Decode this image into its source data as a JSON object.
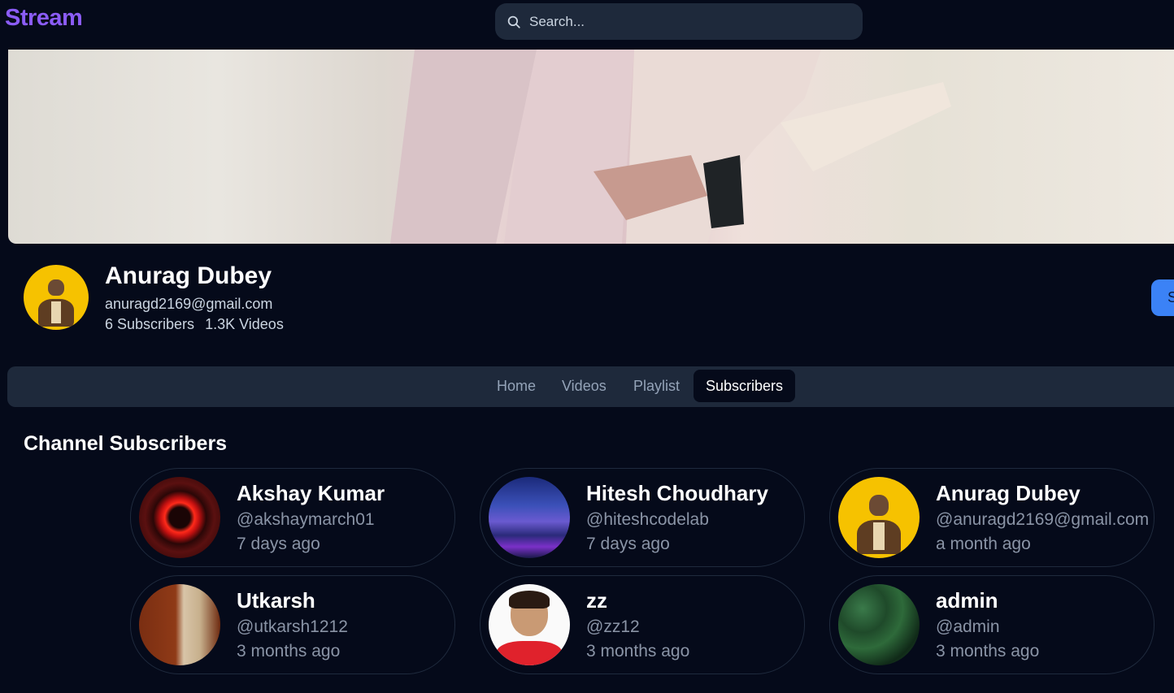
{
  "app": {
    "logo": "Stream"
  },
  "search": {
    "placeholder": "Search..."
  },
  "profile": {
    "name": "Anurag Dubey",
    "email": "anuragd2169@gmail.com",
    "subscribers": "6 Subscribers",
    "videos": "1.3K Videos",
    "subscribe_label": "S"
  },
  "tabs": [
    {
      "label": "Home"
    },
    {
      "label": "Videos"
    },
    {
      "label": "Playlist"
    },
    {
      "label": "Subscribers",
      "active": true
    }
  ],
  "section": {
    "title": "Channel Subscribers"
  },
  "subscribers": [
    {
      "name": "Akshay Kumar",
      "handle": "@akshaymarch01",
      "when": "7 days ago"
    },
    {
      "name": "Hitesh Choudhary",
      "handle": "@hiteshcodelab",
      "when": "7 days ago"
    },
    {
      "name": "Anurag Dubey",
      "handle": "@anuragd2169@gmail.com",
      "when": "a month ago"
    },
    {
      "name": "Utkarsh",
      "handle": "@utkarsh1212",
      "when": "3 months ago"
    },
    {
      "name": "zz",
      "handle": "@zz12",
      "when": "3 months ago"
    },
    {
      "name": "admin",
      "handle": "@admin",
      "when": "3 months ago"
    }
  ],
  "colors": {
    "accent": "#8b5cf6",
    "primary": "#3b82f6",
    "background": "#050a1a",
    "surface": "#1e293b"
  },
  "icons": {
    "search": "search-icon"
  }
}
